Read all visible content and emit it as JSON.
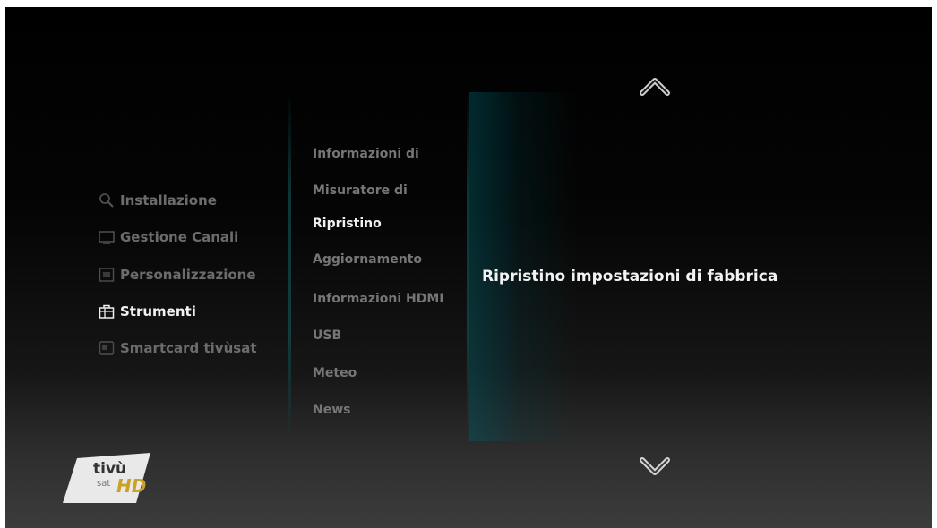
{
  "menu": {
    "items": [
      {
        "label": "Installazione",
        "icon": "search-icon",
        "active": false
      },
      {
        "label": "Gestione Canali",
        "icon": "tv-icon",
        "active": false
      },
      {
        "label": "Personalizzazione",
        "icon": "settings-icon",
        "active": false
      },
      {
        "label": "Strumenti",
        "icon": "toolbox-icon",
        "active": true
      },
      {
        "label": "Smartcard tivùsat",
        "icon": "smartcard-icon",
        "active": false
      }
    ]
  },
  "submenu": {
    "items": [
      {
        "label": "Informazioni di",
        "active": false
      },
      {
        "label": "Misuratore di",
        "active": false
      },
      {
        "label": "Ripristino",
        "active": true
      },
      {
        "label": "Aggiornamento",
        "active": false
      },
      {
        "label": "Informazioni HDMI",
        "active": false
      },
      {
        "label": "USB",
        "active": false
      },
      {
        "label": "Meteo",
        "active": false
      },
      {
        "label": "News",
        "active": false
      }
    ]
  },
  "detail": {
    "text": "Ripristino impostazioni di fabbrica"
  },
  "navigation": {
    "up_icon": "chevron-up-icon",
    "down_icon": "chevron-down-icon"
  },
  "logo": {
    "brand": "tivù",
    "sub": "sat",
    "hd": "HD"
  },
  "colors": {
    "accent": "#0b6e73",
    "active_text": "#f2f2f2",
    "inactive_text": "#6c6c6c",
    "hd_gold": "#c9a227"
  }
}
